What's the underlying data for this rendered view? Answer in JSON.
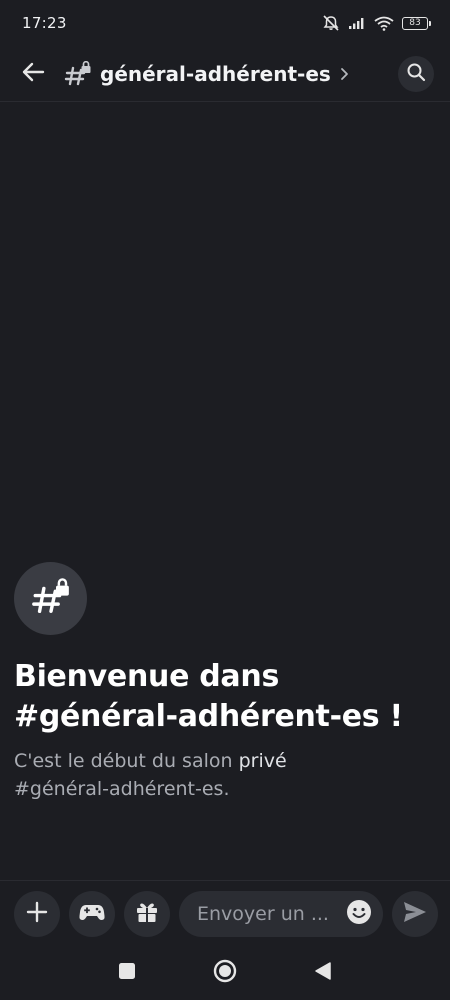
{
  "status_bar": {
    "time": "17:23",
    "battery_level": "83"
  },
  "header": {
    "channel_name": "général-adhérent-es"
  },
  "welcome": {
    "title_line1": "Bienvenue dans",
    "title_line2": "#général-adhérent-es !",
    "desc_prefix": "C'est le début du salon ",
    "desc_strong": "privé",
    "desc_line2": "#général-adhérent-es."
  },
  "composer": {
    "placeholder": "Envoyer un ..."
  },
  "icons": {
    "back": "arrow-left-icon",
    "channel": "locked-hashtag-icon",
    "chevron": "chevron-right-icon",
    "search": "search-icon",
    "plus": "plus-icon",
    "game": "gamepad-icon",
    "gift": "gift-icon",
    "emoji": "emoji-icon",
    "send": "send-icon",
    "nav_recents": "square-icon",
    "nav_home": "circle-icon",
    "nav_back": "triangle-back-icon"
  },
  "colors": {
    "background": "#1c1d22",
    "surface": "#2b2d33",
    "text_primary": "#ffffff",
    "text_muted": "#a9acb3"
  }
}
